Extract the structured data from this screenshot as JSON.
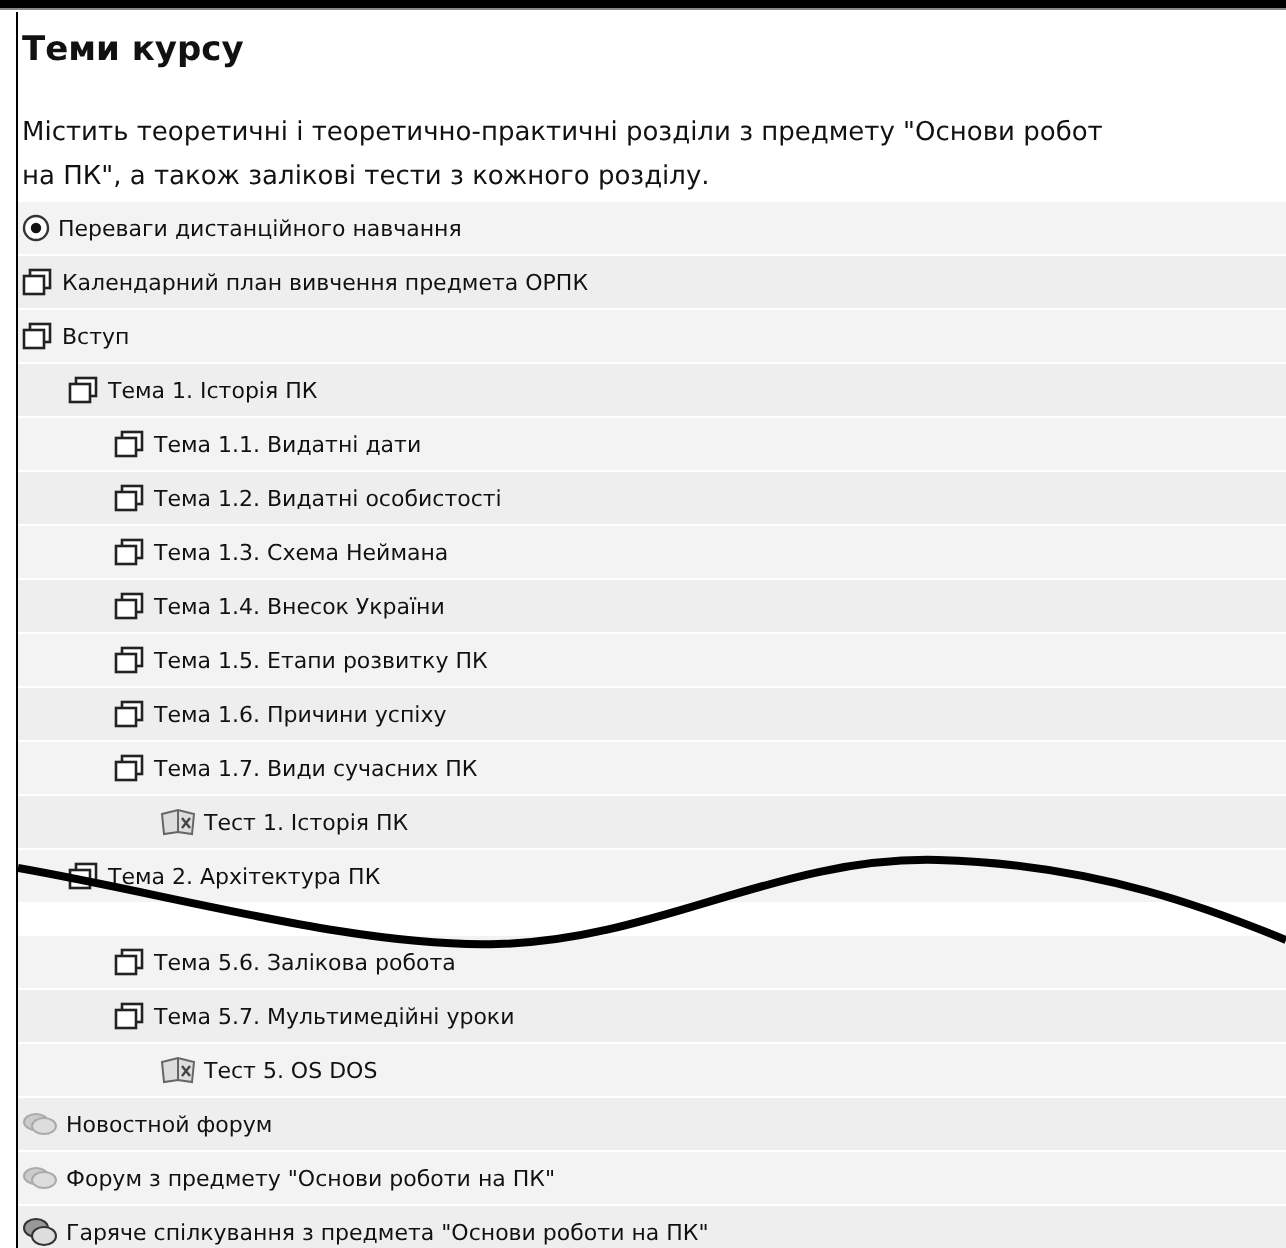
{
  "title": "Теми курсу",
  "description": "Містить теоретичні і теоретично-практичні розділи з предмету \"Основи робот\nна ПК\", а також залікові тести з кожного розділу.",
  "topics": [
    {
      "kind": "label",
      "label": "Переваги дистанційного навчання"
    },
    {
      "kind": "page",
      "label": "Календарний план вивчення предмета ОРПК"
    },
    {
      "kind": "page",
      "label": "Вступ",
      "children": [
        {
          "kind": "page",
          "label": "Тема 1. Історія ПК",
          "children": [
            {
              "kind": "page",
              "label": "Тема 1.1. Видатні дати"
            },
            {
              "kind": "page",
              "label": "Тема 1.2. Видатні особистості"
            },
            {
              "kind": "page",
              "label": "Тема 1.3. Схема Неймана"
            },
            {
              "kind": "page",
              "label": "Тема 1.4. Внесок України"
            },
            {
              "kind": "page",
              "label": "Тема 1.5. Етапи розвитку ПК"
            },
            {
              "kind": "page",
              "label": "Тема 1.6. Причини успіху"
            },
            {
              "kind": "page",
              "label": "Тема 1.7. Види сучасних ПК",
              "children": [
                {
                  "kind": "quiz",
                  "label": "Тест 1. Історія ПК"
                }
              ]
            }
          ]
        },
        {
          "kind": "page",
          "label": "Тема 2. Архітектура ПК"
        }
      ]
    }
  ],
  "topics_after_break": [
    {
      "kind": "page",
      "label": "Тема 5.6. Залікова робота"
    },
    {
      "kind": "page",
      "label": "Тема 5.7. Мультимедійні уроки",
      "children": [
        {
          "kind": "quiz",
          "label": "Тест 5. OS DOS"
        }
      ]
    }
  ],
  "activities": [
    {
      "kind": "forum",
      "label": "Новостной форум"
    },
    {
      "kind": "forum",
      "label": "Форум з предмету \"Основи роботи на ПК\""
    },
    {
      "kind": "chat",
      "label": "Гаряче спілкування з предмета \"Основи роботи на ПК\""
    }
  ]
}
